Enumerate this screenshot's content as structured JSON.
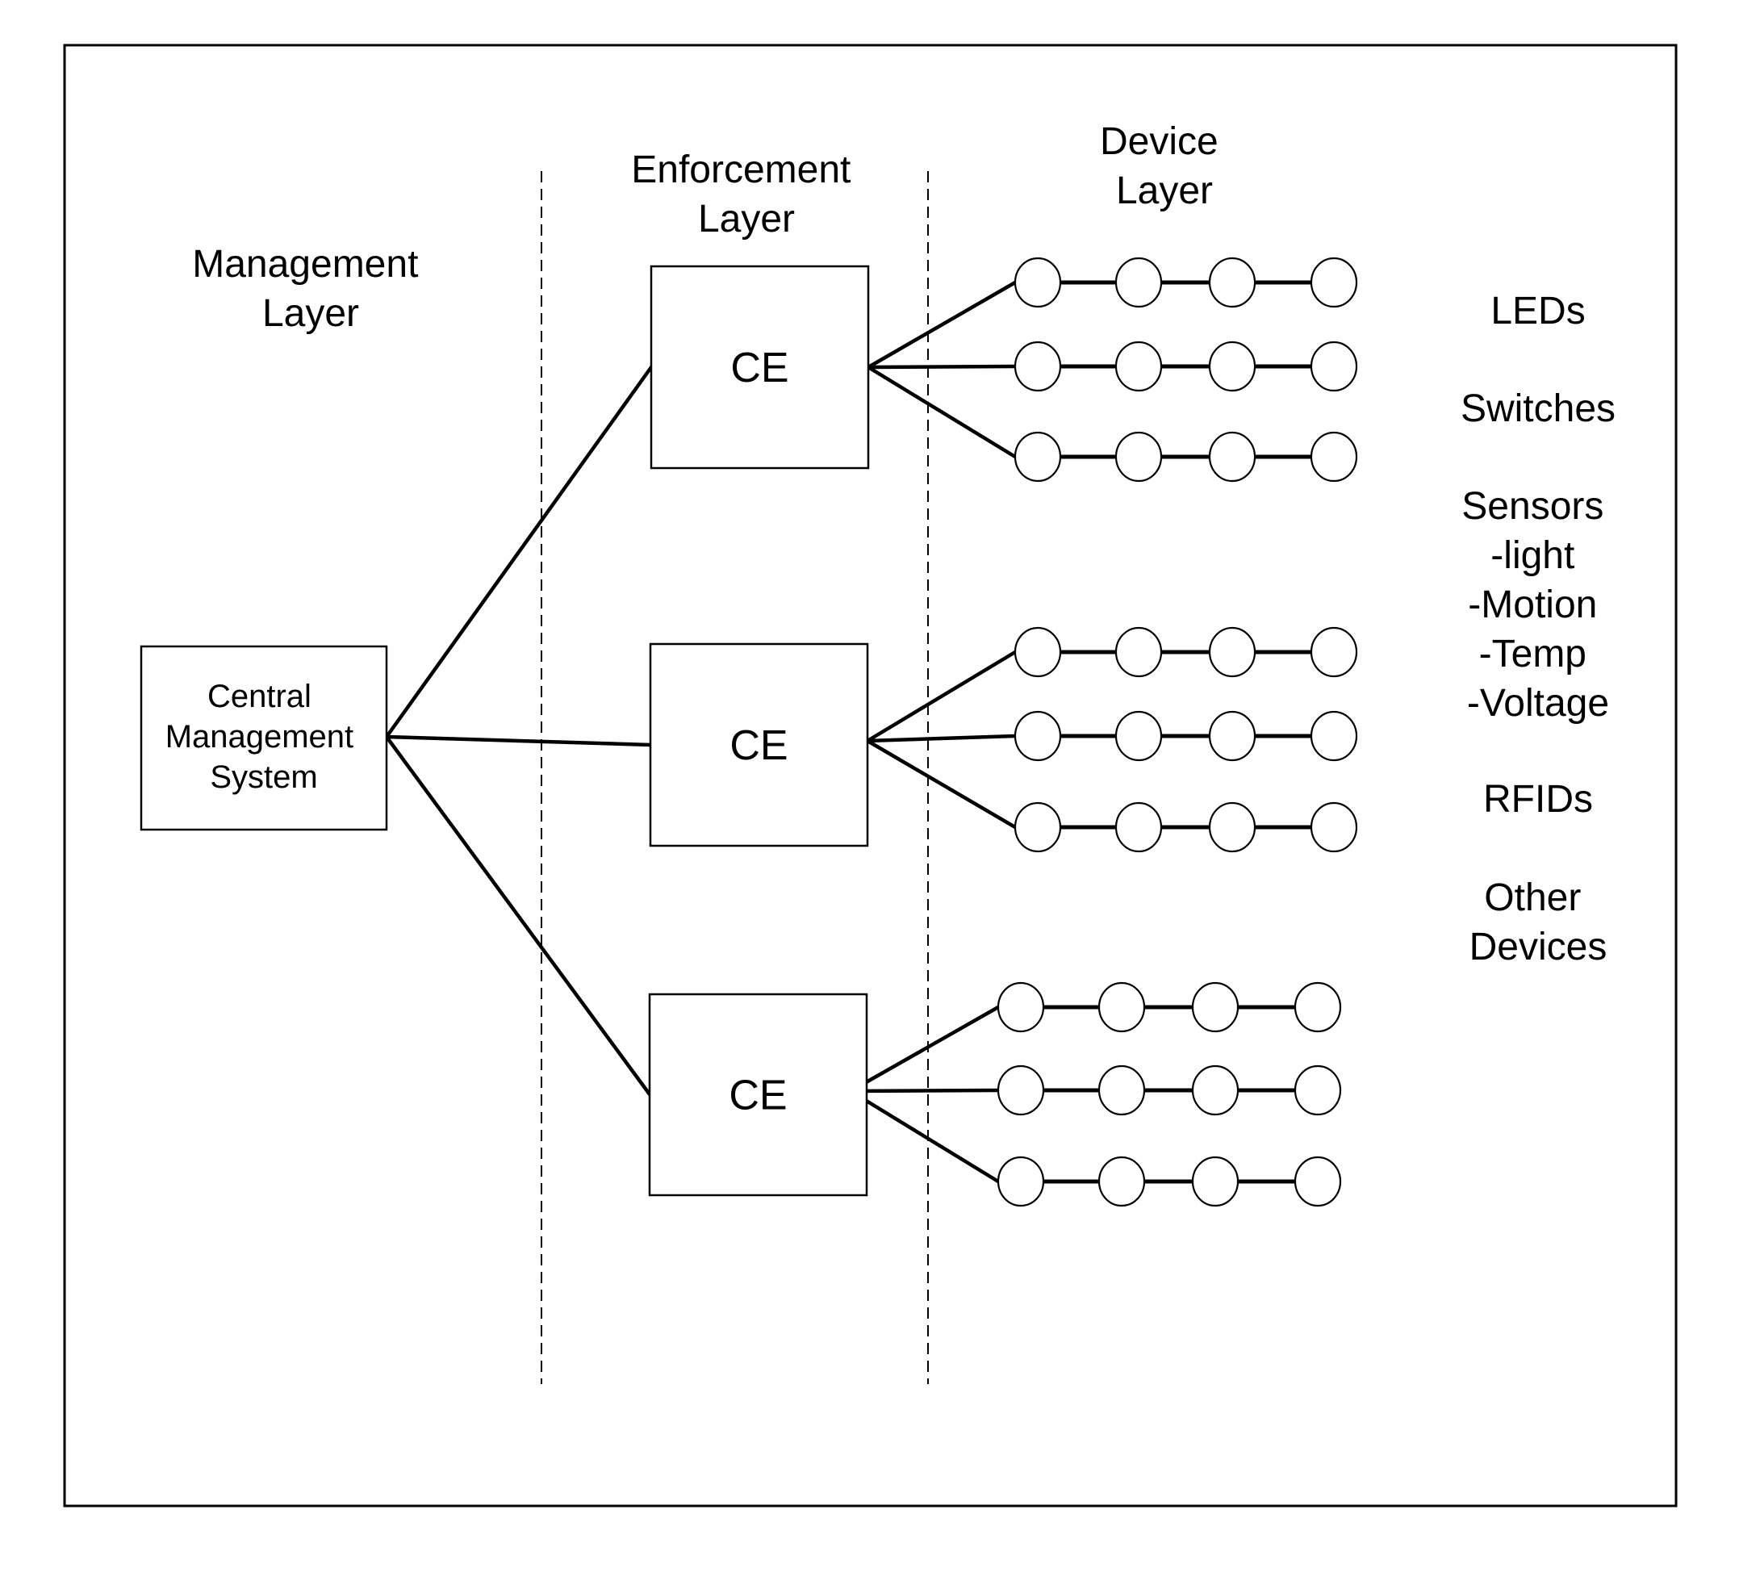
{
  "layers": {
    "management": {
      "line1": "Management",
      "line2": "Layer"
    },
    "enforcement": {
      "line1": "Enforcement",
      "line2": "Layer"
    },
    "device": {
      "line1": "Device",
      "line2": "Layer"
    }
  },
  "central_system": {
    "line1": "Central",
    "line2": "Management",
    "line3": "System"
  },
  "enforcement_nodes": [
    {
      "label": "CE",
      "device_chains": 3,
      "devices_per_chain": 4
    },
    {
      "label": "CE",
      "device_chains": 3,
      "devices_per_chain": 4
    },
    {
      "label": "CE",
      "device_chains": 3,
      "devices_per_chain": 4
    }
  ],
  "device_types": [
    {
      "label": "LEDs"
    },
    {
      "label": "Switches"
    },
    {
      "label": "Sensors",
      "sub": [
        "-light",
        "-Motion",
        "-Temp",
        "-Voltage"
      ]
    },
    {
      "label": "RFIDs"
    },
    {
      "label": "Other",
      "label2": "Devices"
    }
  ]
}
